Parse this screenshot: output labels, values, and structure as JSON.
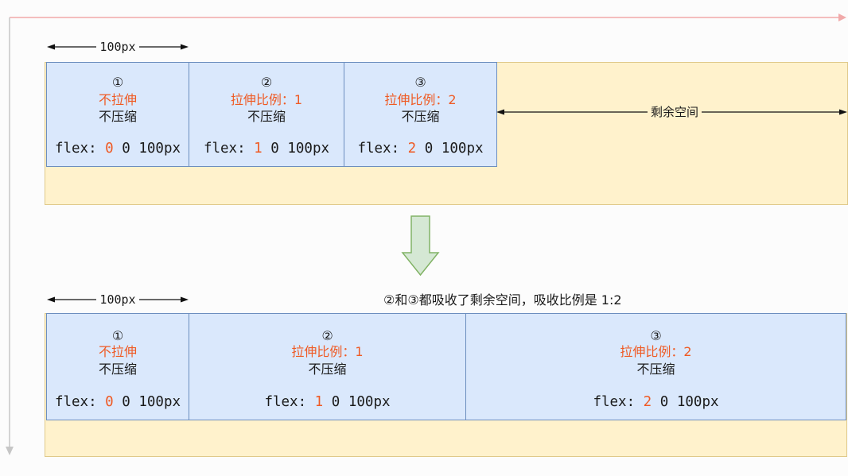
{
  "colors": {
    "page_background": "#fcfcfc",
    "main_axis": "#f1aaaa",
    "cross_axis": "#c6c6c6",
    "container_fill": "#fff2cc",
    "container_border": "#e0c98a",
    "item_fill": "#dae8fc",
    "item_border": "#6c8ebf",
    "highlight_text": "#ef5a24",
    "arrow_fill": "#d5e8d4",
    "arrow_border": "#82b366"
  },
  "before": {
    "width_marker": "100px",
    "items": [
      {
        "index": "①",
        "grow_text": "不拉伸",
        "shrink_text": "不压缩",
        "flex_prefix": "flex:",
        "flex_grow": "0",
        "flex_shrink": "0",
        "flex_basis": "100px"
      },
      {
        "index": "②",
        "grow_text": "拉伸比例：1",
        "shrink_text": "不压缩",
        "flex_prefix": "flex:",
        "flex_grow": "1",
        "flex_shrink": "0",
        "flex_basis": "100px"
      },
      {
        "index": "③",
        "grow_text": "拉伸比例：2",
        "shrink_text": "不压缩",
        "flex_prefix": "flex:",
        "flex_grow": "2",
        "flex_shrink": "0",
        "flex_basis": "100px"
      }
    ],
    "free_space_label": "剩余空间"
  },
  "transition_icon": "down-arrow-icon",
  "after": {
    "width_marker": "100px",
    "caption": "②和③都吸收了剩余空间，吸收比例是 1:2",
    "items": [
      {
        "index": "①",
        "grow_text": "不拉伸",
        "shrink_text": "不压缩",
        "flex_prefix": "flex:",
        "flex_grow": "0",
        "flex_shrink": "0",
        "flex_basis": "100px"
      },
      {
        "index": "②",
        "grow_text": "拉伸比例：1",
        "shrink_text": "不压缩",
        "flex_prefix": "flex:",
        "flex_grow": "1",
        "flex_shrink": "0",
        "flex_basis": "100px"
      },
      {
        "index": "③",
        "grow_text": "拉伸比例：2",
        "shrink_text": "不压缩",
        "flex_prefix": "flex:",
        "flex_grow": "2",
        "flex_shrink": "0",
        "flex_basis": "100px"
      }
    ]
  }
}
